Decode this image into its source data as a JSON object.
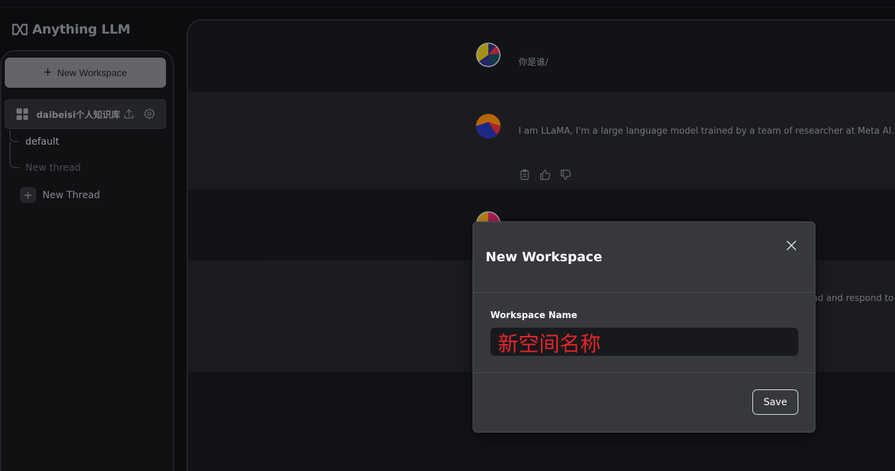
{
  "app": {
    "name": "Anything LLM"
  },
  "sidebar": {
    "new_workspace_label": "New Workspace",
    "workspace": {
      "name": "daibeisi个人知识库"
    },
    "threads": [
      {
        "label": "default"
      },
      {
        "label": "New thread"
      }
    ],
    "new_thread_label": "New Thread"
  },
  "chat": {
    "messages": [
      {
        "role": "user",
        "text": "你是谁/"
      },
      {
        "role": "assistant",
        "text": "I am LLaMA, I'm a large language model trained by a team of researcher at Meta AI."
      },
      {
        "role": "user",
        "text": ""
      },
      {
        "role": "assistant",
        "text": "nd and respond to"
      }
    ]
  },
  "modal": {
    "title": "New Workspace",
    "field_label": "Workspace Name",
    "field_value": "新空间名称",
    "save_label": "Save"
  },
  "colors": {
    "accent_red": "#e3262b",
    "sidebar_bg": "#141518",
    "modal_bg": "#36383e"
  }
}
